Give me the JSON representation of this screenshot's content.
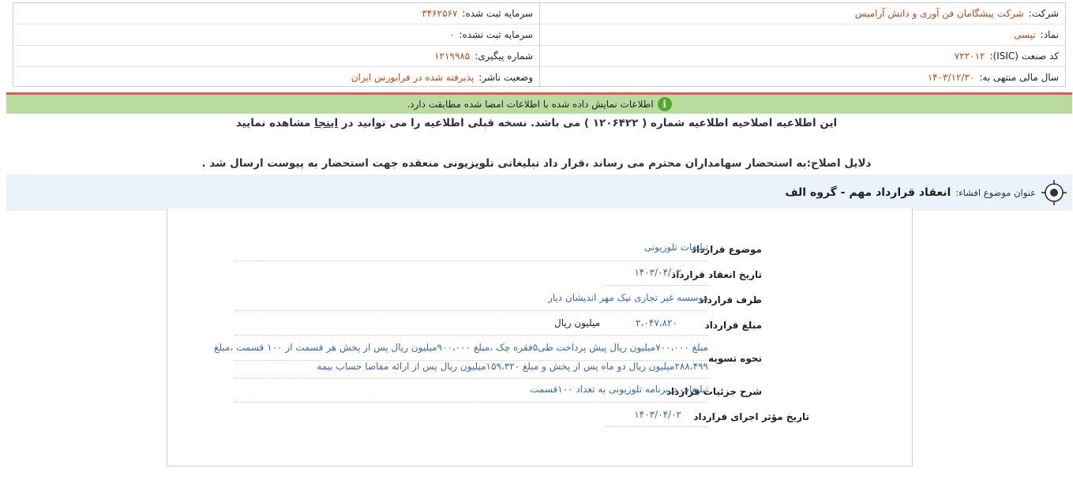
{
  "header": {
    "company_label": "شرکت:",
    "company_value": "شرکت پیشگامان فن آوری و دانش آرامیس",
    "symbol_label": "نماد:",
    "symbol_value": "تپسی",
    "isic_label": "کد صنعت (ISIC):",
    "isic_value": "۷۲۲۰۱۲",
    "fiscal_label": "سال مالی منتهی به:",
    "fiscal_value": "۱۴۰۳/۱۲/۳۰",
    "registered_capital_label": "سرمایه ثبت شده:",
    "registered_capital_value": "۳۴۶۲۵۶۷",
    "unregistered_capital_label": "سرمایه ثبت نشده:",
    "unregistered_capital_value": "۰",
    "tracking_label": "شماره پیگیری:",
    "tracking_value": "۱۲۱۹۹۸۵",
    "publisher_status_label": "وضعیت ناشر:",
    "publisher_status_value": "پذیرفته شده در فرابورس ایران"
  },
  "notice": {
    "info_glyph": "i",
    "text": "اطلاعات نمایش داده شده با اطلاعات امضا شده مطابقت دارد."
  },
  "correction": {
    "text_before": "این اطلاعیه اصلاحیه اطلاعیه شماره ( ۱۲۰۶۴۲۲ ) می باشد. نسخه قبلی اطلاعیه را می توانید در ",
    "link": "اینجا",
    "text_after": " مشاهده نمایید"
  },
  "reasons": "دلایل اصلاح:به استحضار سهامداران محترم می رساند ،قرار داد تبلیغاتی تلویزیونی منعقده جهت استحضار به پیوست ارسال شد .",
  "subject": {
    "label": "عنوان موضوع افشاء:",
    "value": "انعقاد قرارداد مهم - گروه الف"
  },
  "contract": {
    "subject_label": "موضوع قرارداد",
    "subject_value": "تبلیغات تلوزیونی",
    "date_label": "تاریخ انعقاد قرارداد",
    "date_value": "۱۴۰۳/۰۴/۰۲",
    "party_label": "طرف قرارداد",
    "party_value": "موسسه غیر تجاری نیک مهر اندیشان دیار",
    "amount_label": "مبلغ قرارداد",
    "amount_value": "۲،۰۴۷،۸۲۰",
    "amount_unit": "میلیون ریال",
    "settlement_label": "نحوه تسویه",
    "settlement_line1": "مبلغ ۷۰۰،۰۰۰میلیون ریال پیش پرداخت طی۵فقره چک ،مبلغ ۹۰۰،۰۰۰میلیون ریال پس از پخش هر قسمت از ۱۰۰ قسمت ،مبلغ",
    "settlement_line2": "۲۸۸،۴۹۹میلیون ریال دو ماه پس از پخش و مبلغ ۱۵۹،۳۲۰میلیون ریال پس از ارائه مفاصا حساب بیمه",
    "details_label": "شرح جزئیات قرارداد",
    "details_value": "تبلیغات دربرنامه تلوزیونی به تعداد ۱۰۰قسمت",
    "effective_label": "تاریخ مؤثر اجرای قرارداد",
    "effective_value": "۱۴۰۳/۰۴/۰۲"
  }
}
